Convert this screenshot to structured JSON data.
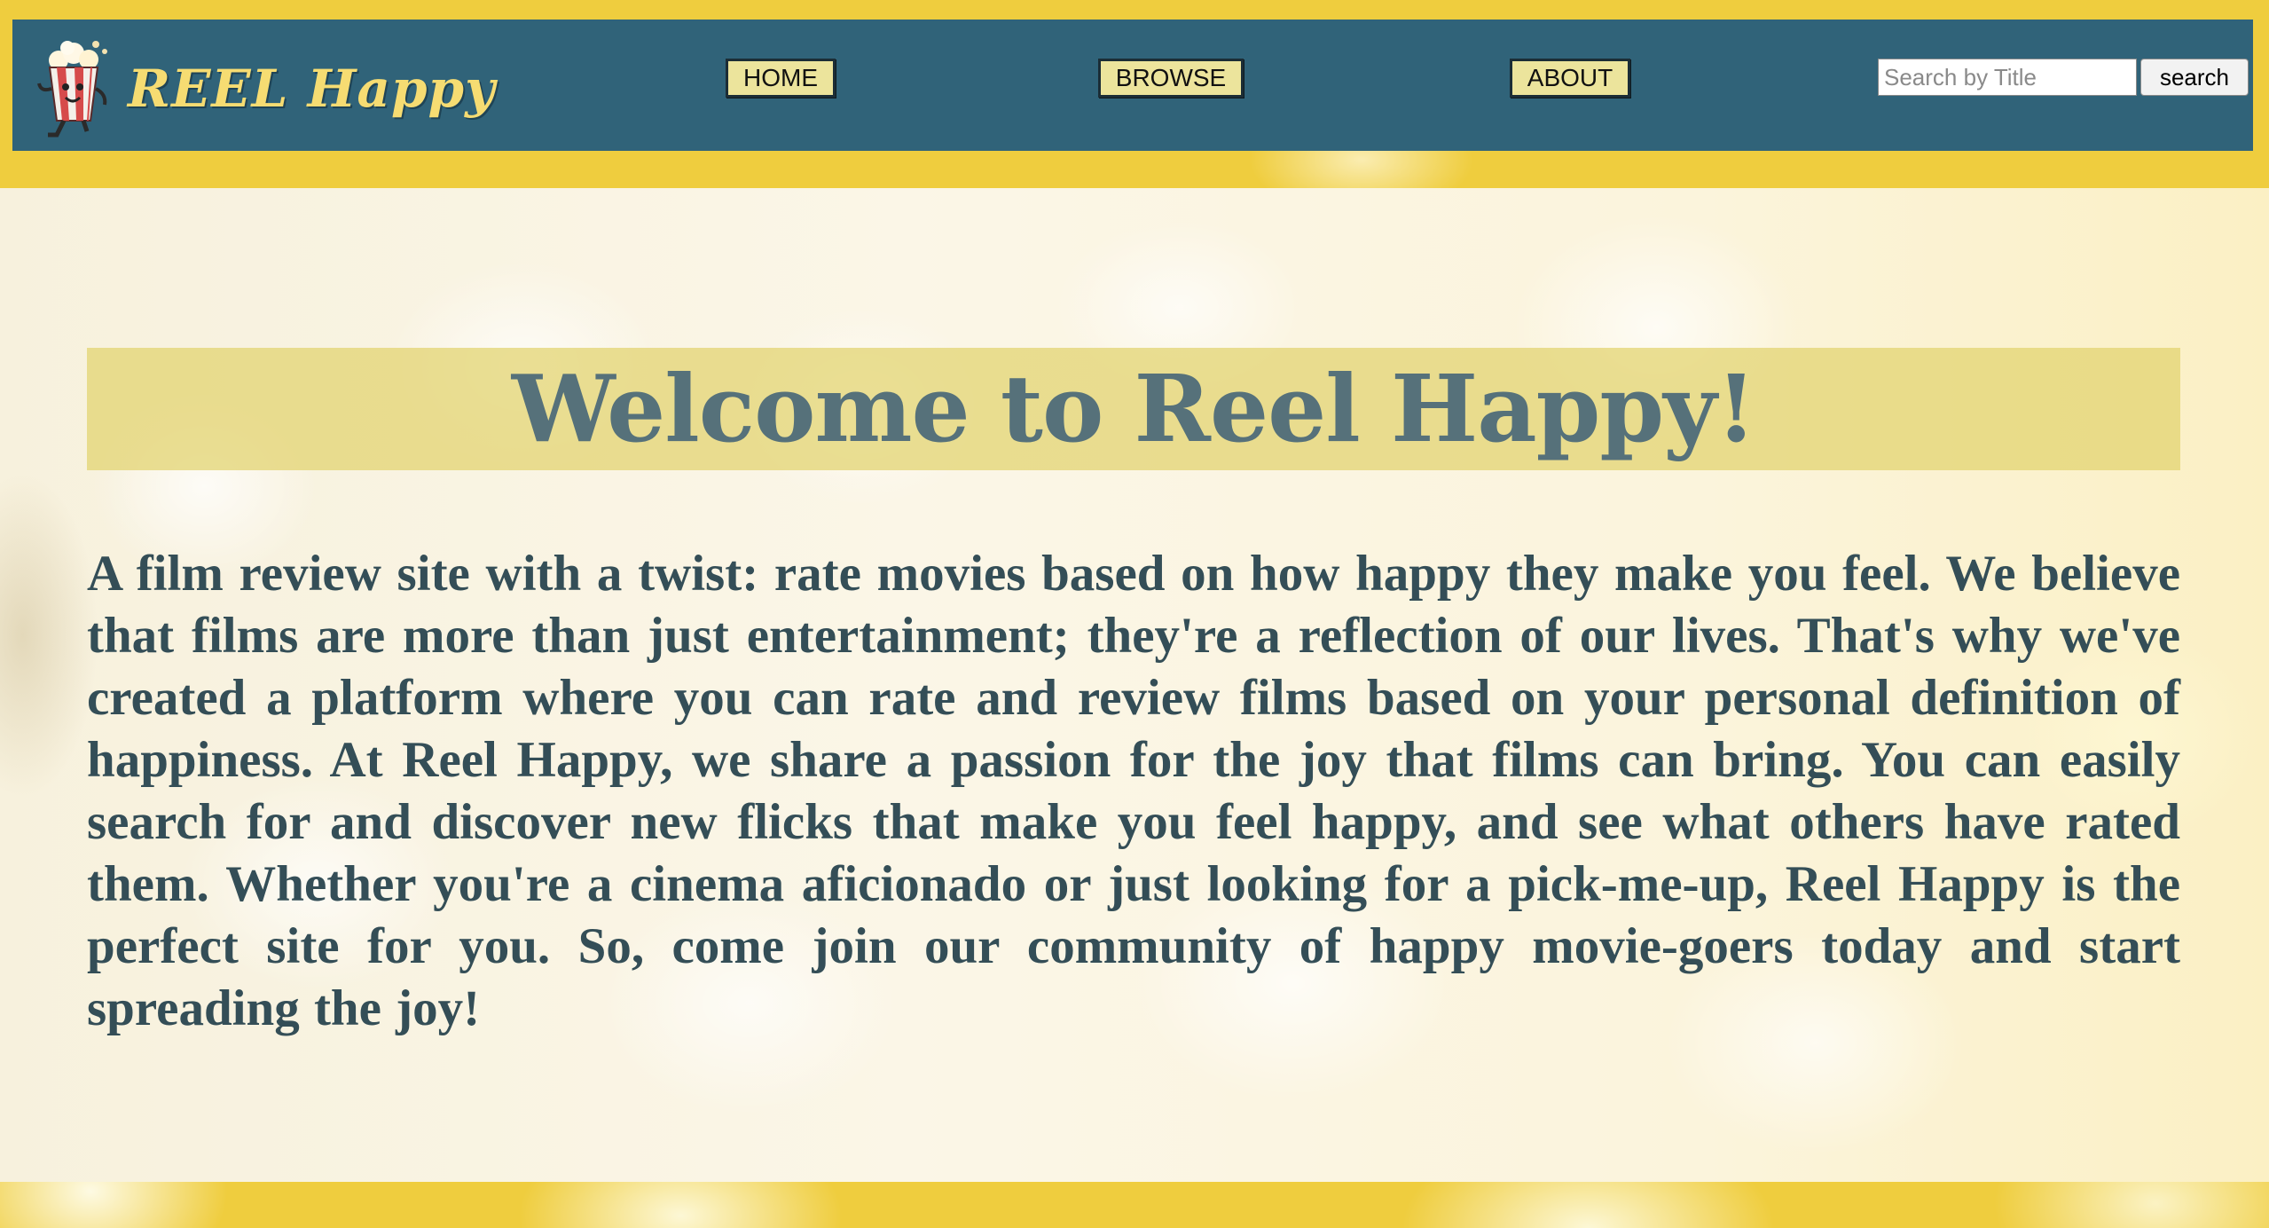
{
  "header": {
    "brand": "REEL Happy",
    "logo_icon": "popcorn-mascot-icon",
    "nav": {
      "home": "HOME",
      "browse": "BROWSE",
      "about": "ABOUT"
    },
    "search": {
      "placeholder": "Search by Title",
      "value": "",
      "button_label": "search"
    }
  },
  "main": {
    "title": "Welcome to Reel Happy!",
    "intro": "A film review site with a twist: rate movies based on how happy they make you feel. We believe that films are more than just entertainment; they're a reflection of our lives. That's why we've created a platform where you can rate and review films based on your personal definition of happiness. At Reel Happy, we share a passion for the joy that films can bring. You can easily search for and discover new flicks that make you feel happy, and see what others have rated them. Whether you're a cinema aficionado or just looking for a pick-me-up, Reel Happy is the perfect site for you. So, come join our community of happy movie-goers today and start spreading the joy!"
  },
  "colors": {
    "header_bg": "#306379",
    "page_bg": "#efcd3e",
    "brand_text": "#f6dc72",
    "nav_button_bg": "#ece49c",
    "title_band": "#e2d26e",
    "title_text": "#56717a",
    "body_text": "#344e57"
  }
}
